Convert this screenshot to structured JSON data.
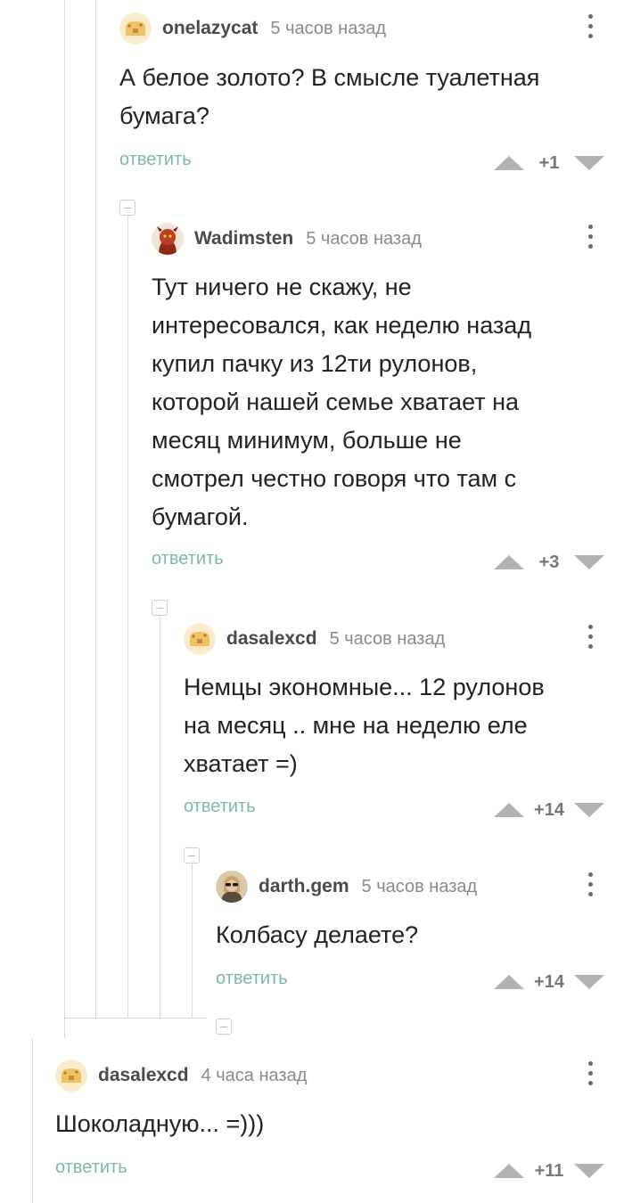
{
  "comments": [
    {
      "nick": "onelazycat",
      "time": "5 часов назад",
      "lines": [
        "А белое золото? В смысле туалетная",
        "бумага?"
      ],
      "reply": "ответить",
      "rating": "+1",
      "avatar": "bread-avatar"
    },
    {
      "nick": "Wadimsten",
      "time": "5 часов назад",
      "lines": [
        "Тут ничего не скажу, не",
        "интересовался, как неделю назад",
        "купил пачку из 12ти рулонов,",
        "которой нашей семье хватает на",
        "месяц минимум, больше не",
        "смотрел честно говоря что там с",
        "бумагой."
      ],
      "reply": "ответить",
      "rating": "+3",
      "avatar": "red-creature-avatar"
    },
    {
      "nick": "dasalexcd",
      "time": "5 часов назад",
      "lines": [
        "Немцы экономные... 12 рулонов",
        "на месяц .. мне на неделю еле",
        "хватает =)"
      ],
      "reply": "ответить",
      "rating": "+14",
      "avatar": "bread-avatar"
    },
    {
      "nick": "darth.gem",
      "time": "5 часов назад",
      "lines": [
        "Колбасу делаете?"
      ],
      "reply": "ответить",
      "rating": "+14",
      "avatar": "person-sunglasses-avatar"
    },
    {
      "nick": "dasalexcd",
      "time": "4 часа назад",
      "lines": [
        "Шоколадную... =)))"
      ],
      "reply": "ответить",
      "rating": "+11",
      "avatar": "bread-avatar"
    }
  ],
  "colors": {
    "reply_link": "#7fb8ab",
    "vote_arrow": "#b2b2b2",
    "thread_line": "#d9d9d9"
  }
}
